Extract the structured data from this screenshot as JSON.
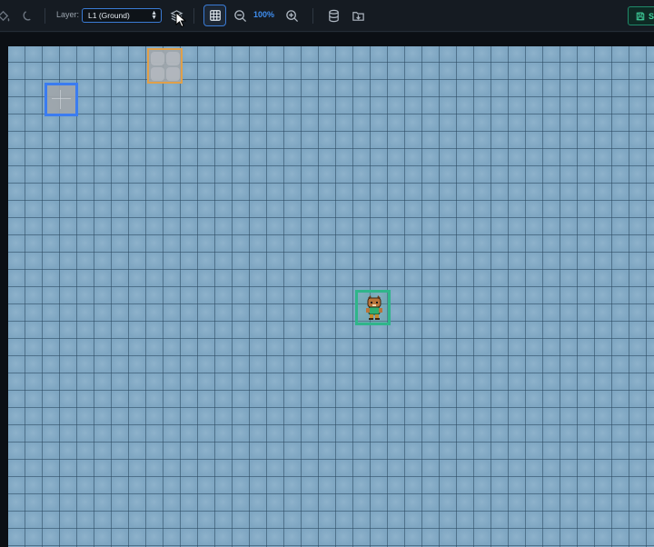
{
  "toolbar": {
    "layer_label": "Layer:",
    "layer_value": "L1 (Ground)",
    "zoom_value": "100%",
    "save_label": "S",
    "icons": [
      "fill-bucket-icon",
      "moon-icon",
      "layers-icon",
      "grid-icon",
      "zoom-out-icon",
      "zoom-in-icon",
      "database-icon",
      "import-folder-icon",
      "save-icon"
    ]
  },
  "canvas": {
    "background": "#7ea6c2",
    "selections": [
      {
        "name": "blue-selection",
        "color": "#3b7cf0"
      },
      {
        "name": "orange-selection",
        "color": "#e0a04a"
      },
      {
        "name": "green-selection",
        "color": "#2fb58a",
        "content": "character-sprite"
      }
    ]
  },
  "colors": {
    "accent": "#3f8ef0",
    "save": "#3ecf9a"
  }
}
